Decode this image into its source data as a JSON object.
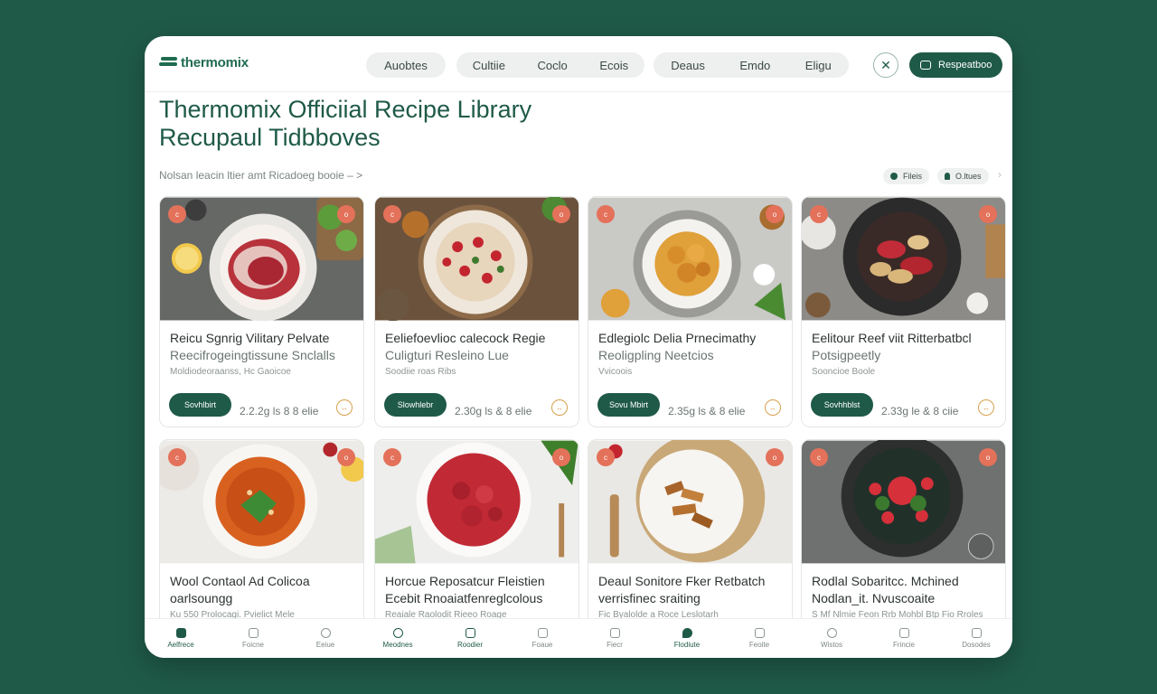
{
  "header": {
    "logo": "thermomix",
    "nav_groups": [
      [
        "Auobtes"
      ],
      [
        "Cultiie",
        "Coclo",
        "Ecois"
      ],
      [
        "Deaus",
        "Emdo",
        "Eligu"
      ]
    ],
    "close_icon": "close-icon",
    "respond_label": "Respeatboo"
  },
  "page": {
    "title_line1": "Thermomix Officiial Recipe Library",
    "title_line2": "Recupaul Tidbboves",
    "subtitle": "Nolsan leacin ltier amt Ricadoeg booie – >",
    "chip1": "Fileis",
    "chip2": "O.ltues"
  },
  "cards": [
    {
      "line1": "Reicu Sgnrig Vilitary Pelvate",
      "line2": "Reecifrogeingtissune Snclalls",
      "line3": "Moldiodeoraanss, Hc Gaoicoe",
      "save": "Sovhlbirt",
      "meta": "2.2.2g ls  8  8 elie",
      "more": "↔"
    },
    {
      "line1": "Eeliefoevlioc calecock Regie",
      "line2": "Culigturi Resleino Lue",
      "line3": "Soodiie roas Ribs",
      "save": "Slowhlebr",
      "meta": "2.30g ls  &  8 elie",
      "more": "↔"
    },
    {
      "line1": "Edlegiolc Delia Prnecimathy",
      "line2": "Reoligpling Neetcios",
      "line3": "Vvicoois",
      "save": "Sovu Mbirt",
      "meta": "2.35g ls  &  8 elie",
      "more": "↔"
    },
    {
      "line1": "Eelitour Reef viit Ritterbatbcl",
      "line2": "Potsigpeetly",
      "line3": "Sooncioe Boole",
      "save": "Sovhhblst",
      "meta": "2.33g le  &  8 ciie",
      "more": "↔"
    },
    {
      "line1": "Wool Contaol Ad Colicoa",
      "line2": "oarlsoungg",
      "line3": "Ku 550 Prolocagi. Pvielict Mele",
      "save": "",
      "meta": "",
      "more": ""
    },
    {
      "line1": "Horcue Reposatcur Fleistien",
      "line2": "Ecebit Rnoaiatfenreglcolous",
      "line3": "Reaiale Raolodit Rieeo Roage",
      "save": "",
      "meta": "",
      "more": ""
    },
    {
      "line1": "Deaul Sonitore Fker Retbatch",
      "line2": "verrisfinec sraiting",
      "line3": "Fic Byalolde a Roce Leslotarh",
      "save": "",
      "meta": "",
      "more": ""
    },
    {
      "line1": "Rodlal Sobaritcc. Mchined",
      "line2": "Nodlan_it. Nvuscoaite",
      "line3": "S Mf Nlmie Feon Rrb Mohbl Btp Fio Rroles",
      "save": "",
      "meta": "",
      "more": ""
    }
  ],
  "badges": [
    "c",
    "o"
  ],
  "bottom_nav": [
    {
      "label": "Aelfrece",
      "icon": "home-icon"
    },
    {
      "label": "Foicne",
      "icon": "grid-icon"
    },
    {
      "label": "Eeiue",
      "icon": "circle-icon"
    },
    {
      "label": "Meodnes",
      "icon": "user-icon"
    },
    {
      "label": "Roodier",
      "icon": "chef-icon"
    },
    {
      "label": "Foaue",
      "icon": "bag-icon"
    },
    {
      "label": "Fiecr",
      "icon": "calendar-icon"
    },
    {
      "label": "Flodiute",
      "icon": "leaf-icon"
    },
    {
      "label": "Feoite",
      "icon": "box-icon"
    },
    {
      "label": "Wistos",
      "icon": "chat-icon"
    },
    {
      "label": "Frincie",
      "icon": "pin-icon"
    },
    {
      "label": "Dosodes",
      "icon": "music-icon"
    }
  ],
  "colors": {
    "brand": "#1f5a48",
    "accent": "#e4715a",
    "background": "#1f5a48"
  }
}
